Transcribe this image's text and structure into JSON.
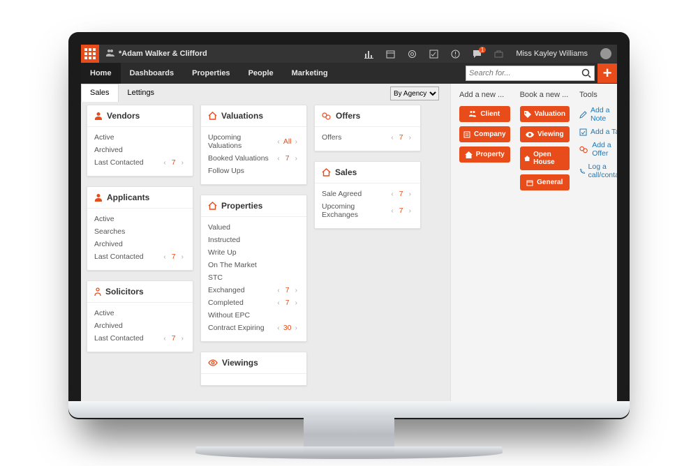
{
  "topbar": {
    "title": "*Adam Walker & Clifford",
    "notif_count": "1",
    "username": "Miss Kayley Williams"
  },
  "nav": {
    "items": [
      "Home",
      "Dashboards",
      "Properties",
      "People",
      "Marketing"
    ],
    "active": 0
  },
  "search": {
    "placeholder": "Search for..."
  },
  "tabs": {
    "items": [
      "Sales",
      "Lettings"
    ],
    "active": 0
  },
  "filter": {
    "label": "By Agency"
  },
  "col1": [
    {
      "title": "Vendors",
      "icon": "person",
      "rows": [
        {
          "label": "Active"
        },
        {
          "label": "Archived"
        },
        {
          "label": "Last Contacted",
          "num": "7",
          "nav": true
        }
      ]
    },
    {
      "title": "Applicants",
      "icon": "person",
      "rows": [
        {
          "label": "Active"
        },
        {
          "label": "Searches"
        },
        {
          "label": "Archived"
        },
        {
          "label": "Last Contacted",
          "num": "7",
          "nav": true
        }
      ]
    },
    {
      "title": "Solicitors",
      "icon": "person-outline",
      "rows": [
        {
          "label": "Active"
        },
        {
          "label": "Archived"
        },
        {
          "label": "Last Contacted",
          "num": "7",
          "nav": true
        }
      ]
    }
  ],
  "col2": [
    {
      "title": "Valuations",
      "icon": "home",
      "rows": [
        {
          "label": "Upcoming Valuations",
          "num": "All",
          "nav": true,
          "red": true
        },
        {
          "label": "Booked Valuations",
          "num": "7",
          "nav": true
        },
        {
          "label": "Follow Ups"
        }
      ]
    },
    {
      "title": "Properties",
      "icon": "home",
      "rows": [
        {
          "label": "Valued"
        },
        {
          "label": "Instructed"
        },
        {
          "label": "Write Up"
        },
        {
          "label": "On The Market"
        },
        {
          "label": "STC"
        },
        {
          "label": "Exchanged",
          "num": "7",
          "nav": true
        },
        {
          "label": "Completed",
          "num": "7",
          "nav": true
        },
        {
          "label": "Without EPC"
        },
        {
          "label": "Contract Expiring",
          "num": "30",
          "nav": true
        }
      ]
    },
    {
      "title": "Viewings",
      "icon": "eye",
      "rows": []
    }
  ],
  "col3": [
    {
      "title": "Offers",
      "icon": "offers",
      "rows": [
        {
          "label": "Offers",
          "num": "7",
          "nav": true
        }
      ]
    },
    {
      "title": "Sales",
      "icon": "home",
      "rows": [
        {
          "label": "Sale Agreed",
          "num": "7",
          "nav": true
        },
        {
          "label": "Upcoming Exchanges",
          "num": "7",
          "nav": true
        }
      ]
    }
  ],
  "side": {
    "add": {
      "header": "Add a new ...",
      "buttons": [
        {
          "label": "Client",
          "icon": "people"
        },
        {
          "label": "Company",
          "icon": "building"
        },
        {
          "label": "Property",
          "icon": "home"
        }
      ]
    },
    "book": {
      "header": "Book a new ...",
      "buttons": [
        {
          "label": "Valuation",
          "icon": "tag"
        },
        {
          "label": "Viewing",
          "icon": "eye"
        },
        {
          "label": "Open House",
          "icon": "home"
        },
        {
          "label": "General",
          "icon": "calendar"
        }
      ]
    },
    "tools": {
      "header": "Tools",
      "links": [
        {
          "label": "Add a Note",
          "icon": "pencil"
        },
        {
          "label": "Add a Task",
          "icon": "check"
        },
        {
          "label": "Add a Offer",
          "icon": "offers"
        },
        {
          "label": "Log a call/contact",
          "icon": "phone"
        }
      ]
    }
  }
}
